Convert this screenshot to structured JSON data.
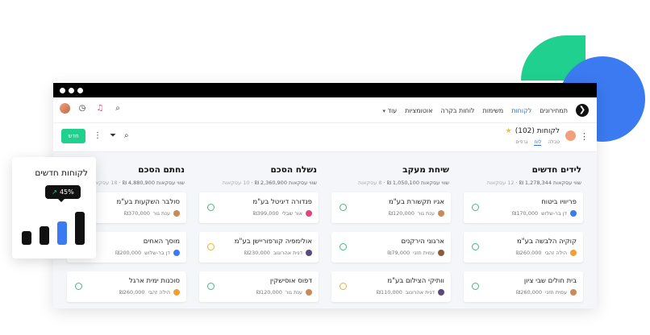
{
  "colors": {
    "accent_green": "#1fd08f",
    "accent_blue": "#3b7af0",
    "link_blue": "#2e6bd6"
  },
  "nav": {
    "logo_icon": "arrow-left-circle-icon",
    "links": [
      "תמחירונים",
      "לקוחות",
      "משימות",
      "לוחות בקרה",
      "אוטומציות",
      "עוד"
    ],
    "active": "לקוחות"
  },
  "toolbar": {
    "board_title": "לקוחות (102)",
    "views": [
      "טבלה",
      "לוח",
      "גרפים"
    ],
    "new_label": "חדש"
  },
  "columns": [
    {
      "title": "לידים חדשים",
      "sum_label": "שווי עסקאות 1,278,344 ₪",
      "count_label": "12 עסקאות",
      "cards": [
        {
          "name": "פריוויו ביטוח",
          "person": "דן בר-שלוש",
          "value": "₪170,000",
          "status": "check",
          "avatar_color": "#3b7af0"
        },
        {
          "name": "קוקיה הלבשה בע\"מ",
          "person": "הילה זהבי",
          "value": "₪260,000",
          "status": "check",
          "avatar_color": "#f0a030"
        },
        {
          "name": "בית חולים שבי ציון",
          "person": "עמית חזני",
          "value": "₪260,000",
          "status": "check",
          "avatar_color": "#c98a5a"
        }
      ]
    },
    {
      "title": "שיחת מעקב",
      "sum_label": "שווי עסקאות 1,050,100 ₪",
      "count_label": "8 עסקאות",
      "cards": [
        {
          "name": "אגיו תקשורת בע\"מ",
          "person": "ענת גור",
          "value": "₪120,000",
          "status": "check",
          "avatar_color": "#c98a5a"
        },
        {
          "name": "ארגוני הירקנים",
          "person": "עמית חזני",
          "value": "₪79,000",
          "status": "check",
          "avatar_color": "#8a5a3a"
        },
        {
          "name": "וותיקי הצילום בע\"מ",
          "person": "דנית אהרונוב",
          "value": "₪110,000",
          "status": "plus",
          "avatar_color": "#5a4a7a"
        }
      ]
    },
    {
      "title": "נשלח הסכם",
      "sum_label": "שווי עסקאות 2,360,900 ₪",
      "count_label": "10 עסקאות",
      "cards": [
        {
          "name": "פנדורה דיגיטל בע\"מ",
          "person": "אור שבלי",
          "value": "₪399,000",
          "status": "check",
          "avatar_color": "#e0457b"
        },
        {
          "name": "אולימפיה קורפוריישן בע\"מ",
          "person": "דנית אהרונוב",
          "value": "₪230,000",
          "status": "plus",
          "avatar_color": "#5a4a7a"
        },
        {
          "name": "דפוס אוסישקין",
          "person": "ענת גור",
          "value": "₪120,000",
          "status": "check",
          "avatar_color": "#c98a5a"
        }
      ]
    },
    {
      "title": "נחתם הסכם",
      "sum_label": "שווי עסקאות 4,880,900 ₪",
      "count_label": "18 עסקאות",
      "cards": [
        {
          "name": "סולבר השקעות בע\"מ",
          "person": "ענת גור",
          "value": "₪370,000",
          "status": "check",
          "avatar_color": "#c98a5a"
        },
        {
          "name": "מוסך האחים",
          "person": "דן בר-שלוש",
          "value": "₪200,000",
          "status": "check",
          "avatar_color": "#3b7af0"
        },
        {
          "name": "סוכנות ימית ארגל",
          "person": "הילה זהבי",
          "value": "₪260,000",
          "status": "check",
          "avatar_color": "#f0a030"
        }
      ]
    }
  ],
  "stat_card": {
    "title": "לקוחות חדשים",
    "badge": "45%",
    "trend_icon": "trend-up-icon",
    "bars": [
      0.38,
      0.5,
      0.62,
      0.9
    ],
    "highlight_index": 2
  }
}
